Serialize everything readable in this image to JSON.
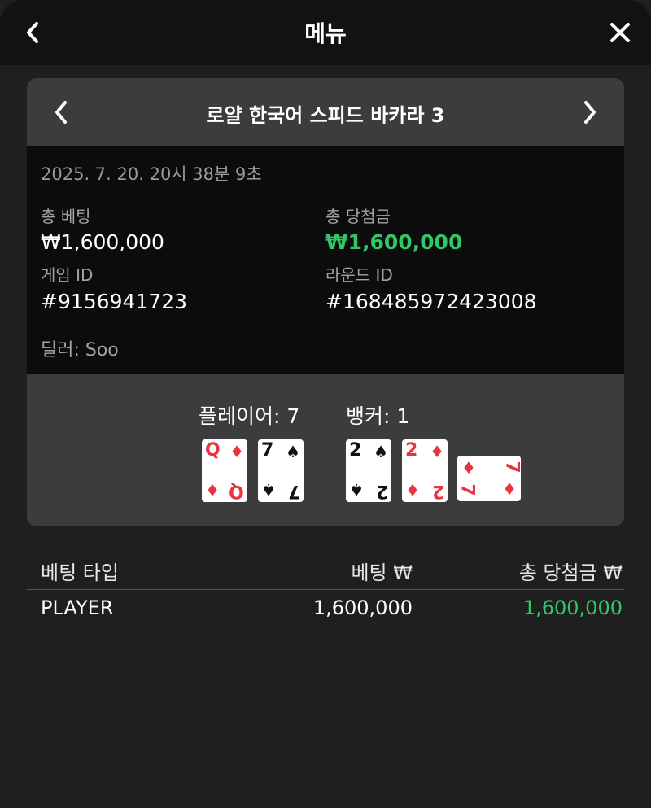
{
  "header": {
    "title": "메뉴"
  },
  "game": {
    "title": "로얄 한국어 스피드 바카라 3",
    "timestamp": "2025. 7. 20. 20시 38분 9초",
    "total_bet_label": "총 베팅",
    "total_bet_value": "₩1,600,000",
    "total_win_label": "총 당첨금",
    "total_win_value": "₩1,600,000",
    "game_id_label": "게임 ID",
    "game_id_value": "#9156941723",
    "round_id_label": "라운드 ID",
    "round_id_value": "#168485972423008",
    "dealer": "딜러: Soo"
  },
  "hands": {
    "player_label": "플레이어: 7",
    "banker_label": "뱅커: 1",
    "player_cards": [
      {
        "rank": "Q",
        "suit": "♦",
        "color": "#e8343f"
      },
      {
        "rank": "7",
        "suit": "♠",
        "color": "#111111"
      }
    ],
    "banker_cards": [
      {
        "rank": "2",
        "suit": "♠",
        "color": "#111111"
      },
      {
        "rank": "2",
        "suit": "♦",
        "color": "#e8343f"
      },
      {
        "rank": "7",
        "suit": "♦",
        "color": "#e8343f",
        "orientation": "sideways"
      }
    ]
  },
  "bets": {
    "col_type": "베팅 타입",
    "col_bet": "베팅 ₩",
    "col_win": "총 당첨금 ₩",
    "rows": [
      {
        "type": "PLAYER",
        "bet": "1,600,000",
        "win": "1,600,000"
      }
    ]
  },
  "colors": {
    "win_green": "#2ec866",
    "panel_bg": "#3c3c3c",
    "info_bg": "#0c0c0c",
    "red_suit": "#e8343f"
  }
}
